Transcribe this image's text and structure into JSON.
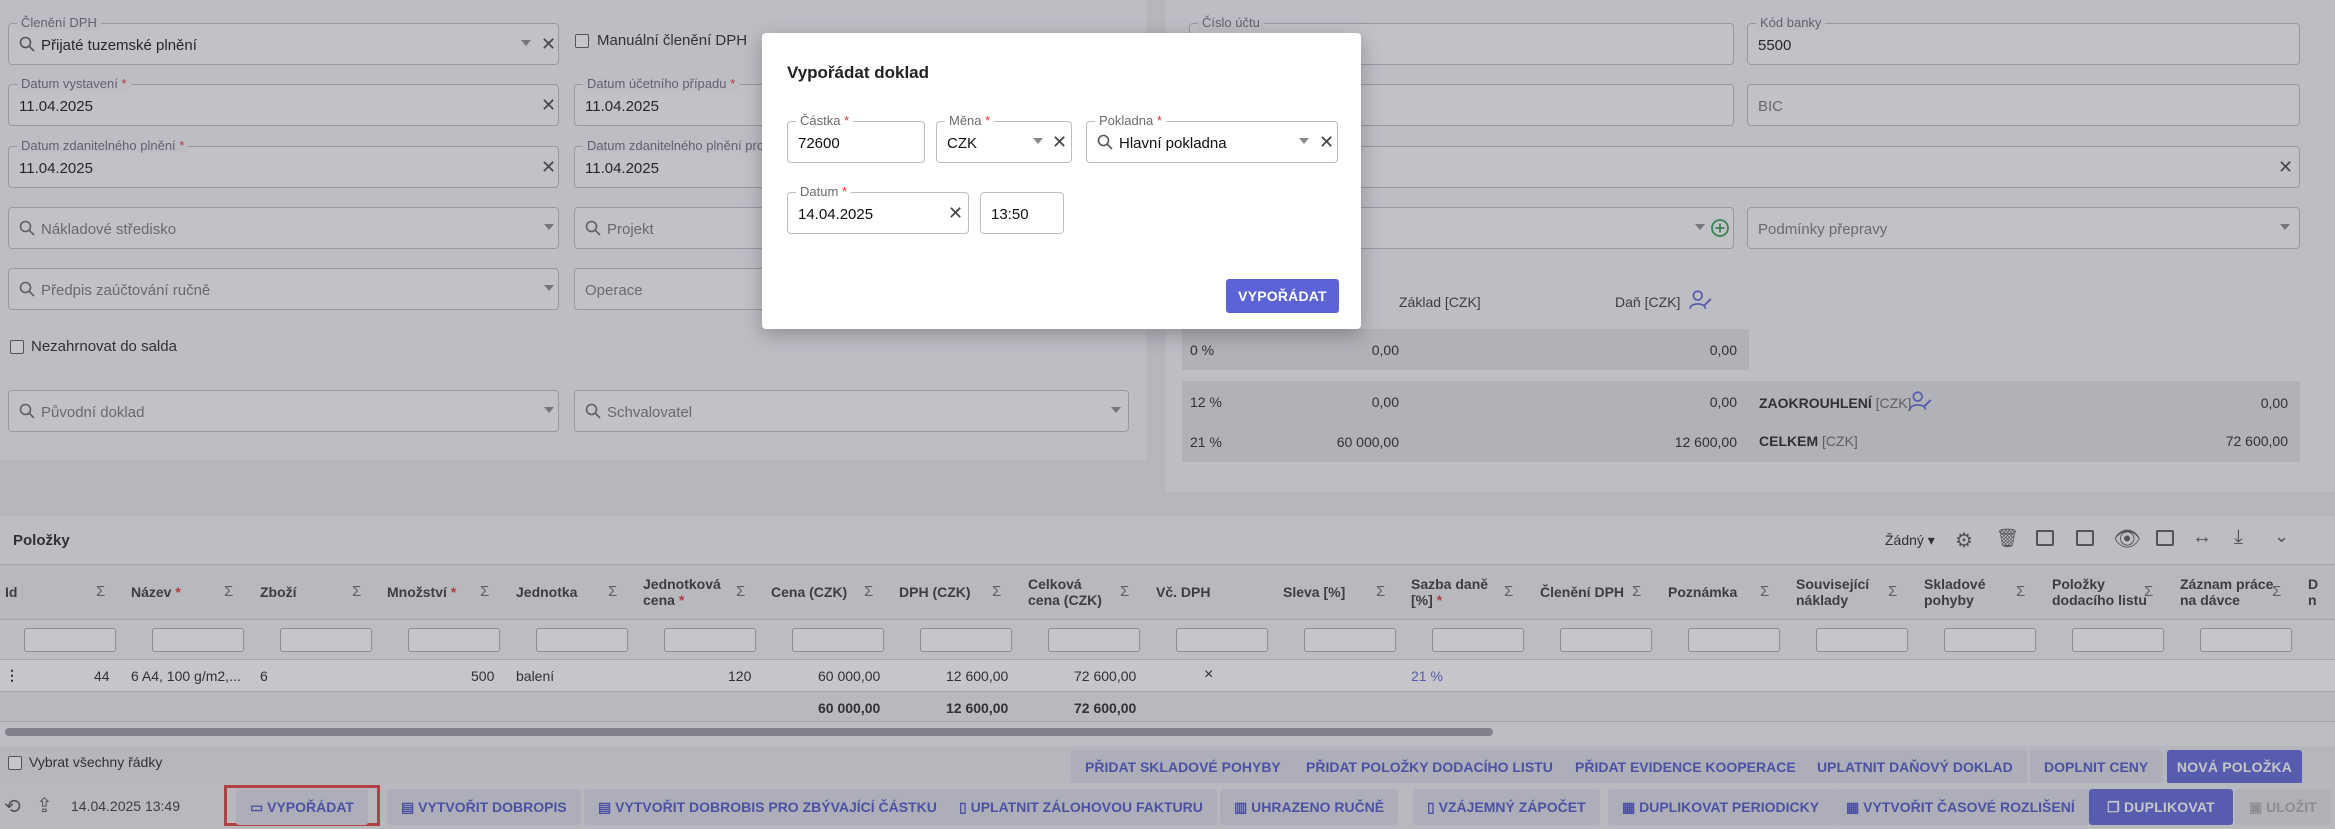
{
  "form": {
    "cleneni_dph": {
      "label": "Členění DPH",
      "value": "Přijaté tuzemské plnění"
    },
    "manualni_cleneni": "Manuální členění DPH",
    "datum_vystaveni": {
      "label": "Datum vystavení",
      "value": "11.04.2025"
    },
    "datum_ucetniho": {
      "label": "Datum účetního případu",
      "value": "11.04.2025"
    },
    "datum_zdanitelneho": {
      "label": "Datum zdanitelného plnění",
      "value": "11.04.2025"
    },
    "datum_zdanitelneho_pro": {
      "label": "Datum zdanitelného plnění pro",
      "value": "11.04.2025"
    },
    "nakladove_stredisko": "Nákladové středisko",
    "projekt": "Projekt",
    "predpis": "Předpis zaúčtování ručně",
    "operace": "Operace",
    "nezahrnovat": "Nezahrnovat do salda",
    "puvodni_doklad": "Původní doklad",
    "schvalovatel": "Schvalovatel",
    "required_mark": "*"
  },
  "right_form": {
    "cislo_uctu": {
      "label": "Číslo účtu",
      "value": ""
    },
    "kod_banky": {
      "label": "Kód banky",
      "value": "5500"
    },
    "bic": "BIC",
    "podminky": "Podmínky přepravy"
  },
  "vat": {
    "zaklad_header": "Základ [CZK]",
    "dan_header": "Daň [CZK]",
    "rows": [
      {
        "rate": "0 %",
        "zaklad": "0,00",
        "dan": "0,00"
      },
      {
        "rate": "12 %",
        "zaklad": "0,00",
        "dan": "0,00"
      },
      {
        "rate": "21 %",
        "zaklad": "60 000,00",
        "dan": "12 600,00"
      }
    ],
    "zaokrouhleni_label": "ZAOKROUHLENÍ",
    "zaokrouhleni_unit": "[CZK]",
    "zaokrouhleni_value": "0,00",
    "celkem_label": "CELKEM",
    "celkem_unit": "[CZK]",
    "celkem_value": "72 600,00"
  },
  "polozky": {
    "title": "Položky",
    "view_select": "Žádný",
    "columns": [
      "Id",
      "Název",
      "Zboží",
      "Množství",
      "Jednotka",
      "Jednotková cena",
      "Cena (CZK)",
      "DPH (CZK)",
      "Celková cena (CZK)",
      "Vč. DPH",
      "Sleva [%]",
      "Sazba daně [%]",
      "Členění DPH",
      "Poznámka",
      "Související náklady",
      "Skladové pohyby",
      "Položky dodacího listu",
      "Záznam práce na dávce",
      "D n"
    ],
    "row": {
      "id": "44",
      "nazev": "6 A4, 100 g/m2,...",
      "zbozi": "6",
      "mnozstvi": "500",
      "jednotka": "balení",
      "jedn_cena": "120",
      "cena": "60 000,00",
      "dph": "12 600,00",
      "celkova": "72 600,00",
      "vc_dph": "×",
      "sazba": "21 %"
    },
    "totals": {
      "cena": "60 000,00",
      "dph": "12 600,00",
      "celkova": "72 600,00"
    },
    "select_all": "Vybrat všechny řádky"
  },
  "upper_buttons": [
    "PŘIDAT SKLADOVÉ POHYBY",
    "PŘIDAT POLOŽKY DODACÍHO LISTU",
    "PŘIDAT EVIDENCE KOOPERACE",
    "UPLATNIT DAŇOVÝ DOKLAD",
    "DOPLNIT CENY",
    "NOVÁ POLOŽKA"
  ],
  "footer": {
    "timestamp": "14.04.2025 13:49",
    "buttons": [
      "VYPOŘÁDAT",
      "VYTVOŘIT DOBROPIS",
      "VYTVOŘIT DOBROBIS PRO ZBÝVAJÍCÍ ČÁSTKU",
      "UPLATNIT ZÁLOHOVOU FAKTURU",
      "UHRAZENO RUČNĚ",
      "VZÁJEMNÝ ZÁPOČET",
      "DUPLIKOVAT PERIODICKY",
      "VYTVOŘIT ČASOVÉ ROZLIŠENÍ",
      "DUPLIKOVAT",
      "ULOŽIT"
    ]
  },
  "modal": {
    "title": "Vypořádat doklad",
    "castka": {
      "label": "Částka",
      "value": "72600"
    },
    "mena": {
      "label": "Měna",
      "value": "CZK"
    },
    "pokladna": {
      "label": "Pokladna",
      "value": "Hlavní pokladna"
    },
    "datum": {
      "label": "Datum",
      "value": "14.04.2025"
    },
    "cas": "13:50",
    "submit": "VYPOŘÁDAT"
  },
  "colors": {
    "accent": "#5b63d6",
    "highlight": "#e53935"
  }
}
